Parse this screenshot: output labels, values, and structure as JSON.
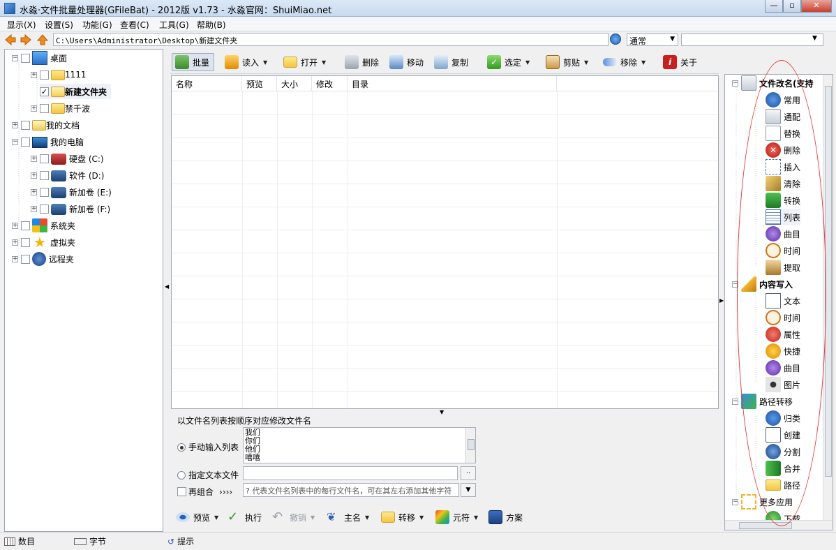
{
  "window": {
    "title": "水淼·文件批量处理器(GFileBat) - 2012版 v1.73 - 水淼官网：ShuiMiao.net"
  },
  "menu": [
    "显示(X)",
    "设置(S)",
    "功能(G)",
    "查看(C)",
    "工具(G)",
    "帮助(B)"
  ],
  "address": {
    "path": "C:\\Users\\Administrator\\Desktop\\新建文件夹",
    "mode": "通常"
  },
  "tree": {
    "items": [
      {
        "label": "桌面",
        "level": 0,
        "icon": "desktop-icon"
      },
      {
        "label": "1111",
        "level": 1,
        "icon": "folder-icon"
      },
      {
        "label": "新建文件夹",
        "level": 1,
        "icon": "folder-open-icon",
        "checked": true,
        "selected": true
      },
      {
        "label": "禁千波",
        "level": 1,
        "icon": "folder-icon"
      },
      {
        "label": "我的文档",
        "level": 0,
        "icon": "documents-icon"
      },
      {
        "label": "我的电脑",
        "level": 0,
        "icon": "computer-icon"
      },
      {
        "label": "硬盘 (C:)",
        "level": 1,
        "icon": "drive-c-icon"
      },
      {
        "label": "软件 (D:)",
        "level": 1,
        "icon": "drive-icon"
      },
      {
        "label": "新加卷 (E:)",
        "level": 1,
        "icon": "drive-icon"
      },
      {
        "label": "新加卷 (F:)",
        "level": 1,
        "icon": "drive-icon"
      },
      {
        "label": "系统夹",
        "level": 0,
        "icon": "windows-icon"
      },
      {
        "label": "虚拟夹",
        "level": 0,
        "icon": "star-icon"
      },
      {
        "label": "远程夹",
        "level": 0,
        "icon": "ftp-icon"
      }
    ]
  },
  "toolbar": {
    "batch": "批量",
    "read": "读入",
    "open": "打开",
    "delete": "删除",
    "move": "移动",
    "copy": "复制",
    "select": "选定",
    "clip": "剪贴",
    "remove": "移除",
    "about": "关于"
  },
  "grid": {
    "columns": [
      "名称",
      "预览",
      "大小",
      "修改",
      "目录"
    ]
  },
  "rename": {
    "title": "以文件名列表按顺序对应修改文件名",
    "manual_label": "手动输入列表",
    "list_lines": [
      "我们",
      "你们",
      "他们",
      "嘻嘻"
    ],
    "file_label": "指定文本文件",
    "browse": "..",
    "combine_label": "再组合",
    "combine_arrows": "››››",
    "combine_hint": "? 代表文件名列表中的每行文件名，可在其左右添加其他字符"
  },
  "bottom_toolbar": {
    "preview": "预览",
    "execute": "执行",
    "undo": "撤销",
    "main_name": "主名",
    "transfer": "转移",
    "meta": "元符",
    "plan": "方案"
  },
  "right_panel": {
    "groups": [
      {
        "label": "文件改名(支持",
        "items": [
          "常用",
          "通配",
          "替换",
          "删除",
          "插入",
          "清除",
          "转换",
          "列表",
          "曲目",
          "时间",
          "提取"
        ]
      },
      {
        "label": "内容写入",
        "items": [
          "文本",
          "时间",
          "属性",
          "快捷",
          "曲目",
          "图片"
        ]
      },
      {
        "label": "路径转移",
        "items": [
          "归类",
          "创建",
          "分割",
          "合并",
          "路径"
        ]
      },
      {
        "label": "更多应用",
        "items": [
          "下载"
        ]
      }
    ]
  },
  "status": {
    "items": "数目",
    "bytes": "字节",
    "hint": "提示"
  },
  "colors": {
    "accent": "#1f5fb5",
    "annotation": "#e23b3b"
  }
}
